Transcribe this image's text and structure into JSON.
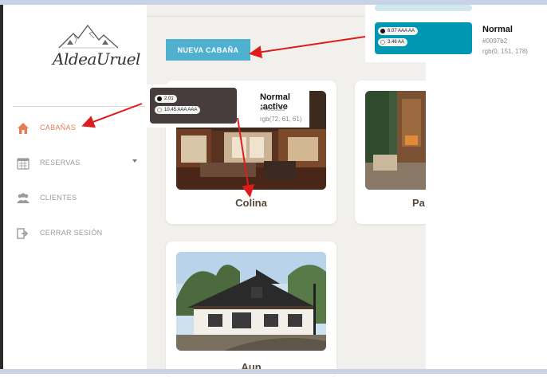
{
  "sidebar": {
    "logo_text": "AldeaUruel",
    "items": [
      {
        "label": "CABAÑAS",
        "icon": "home-icon",
        "active": true
      },
      {
        "label": "RESERVAS",
        "icon": "calendar-icon",
        "active": false
      },
      {
        "label": "CLIENTES",
        "icon": "users-icon",
        "active": false
      },
      {
        "label": "CERRAR SESIÓN",
        "icon": "logout-icon",
        "active": false
      }
    ]
  },
  "main": {
    "new_button_label": "NUEVA CABAÑA",
    "cards": [
      {
        "title": "Colina"
      },
      {
        "title": "Pa"
      },
      {
        "title": "Aun"
      }
    ]
  },
  "annotations": {
    "teal_swatch": {
      "contrast_dark": "6.07 AAA",
      "contrast_dark_badge": "AA",
      "contrast_light": "3.46 AA",
      "name": "Normal",
      "hex": "#0097b2",
      "rgb": "rgb(0, 151, 178)",
      "color": "#0097b2"
    },
    "brown_swatch": {
      "contrast_dark": "2.01",
      "contrast_light": "10.45 AAA",
      "contrast_light_badge": "AAA",
      "name": "Normal :active",
      "hex": "#483d3d",
      "rgb": "rgb(72, 61, 61)",
      "color": "#483d3d"
    }
  },
  "colors": {
    "accent": "#e57d55",
    "button": "#4fb1cf",
    "arrow": "#e01b1b"
  }
}
